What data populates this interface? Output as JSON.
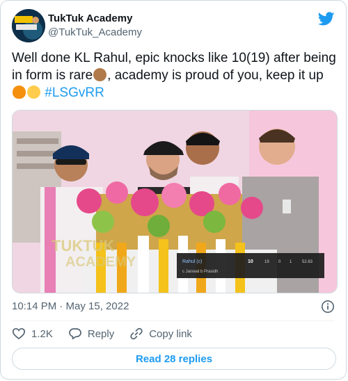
{
  "author": {
    "display_name": "TukTuk Academy",
    "handle": "@TukTuk_Academy"
  },
  "icons": {
    "brand": "twitter-bird-icon",
    "info": "info-icon",
    "like": "heart-icon",
    "reply": "reply-bubble-icon",
    "copy": "link-icon"
  },
  "colors": {
    "brand": "#1d9bf0",
    "text": "#0f1419",
    "secondary": "#536471"
  },
  "tweet": {
    "text_1": "Well done KL Rahul, epic knocks like 10(19) after being in form is rare",
    "text_2": ", academy is proud of you, keep it up",
    "hashtag": "#LSGvRR"
  },
  "media": {
    "watermark_line1": "TUKTUK",
    "watermark_line2": "ACADEMY",
    "scorecard": {
      "batter": "Rahul (c)",
      "dismissal": "c Jaiswal b Prasidh",
      "runs": "10",
      "balls": "19",
      "fours": "0",
      "sixes": "1",
      "strike_rate": "52.63"
    }
  },
  "meta": {
    "timestamp": "10:14 PM · May 15, 2022"
  },
  "actions": {
    "like_count": "1.2K",
    "reply_label": "Reply",
    "copy_label": "Copy link",
    "read_replies": "Read 28 replies"
  }
}
